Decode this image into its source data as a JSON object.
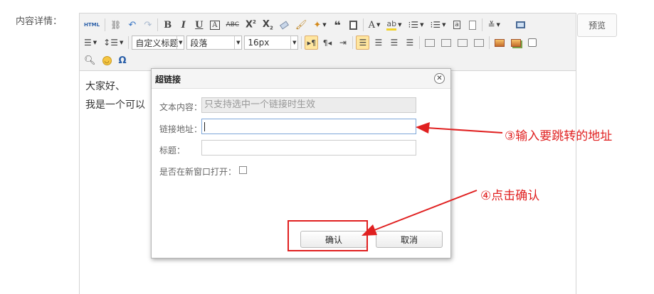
{
  "form": {
    "field_label": "内容详情："
  },
  "editor": {
    "style_select": "自定义标题",
    "paragraph_select": "段落",
    "fontsize_select": "16px",
    "content_lines": [
      "大家好、",
      "我是一个可以"
    ]
  },
  "preview_label": "预览",
  "dialog": {
    "title": "超链接",
    "close_glyph": "✕",
    "text_label": "文本内容：",
    "text_placeholder": "只支持选中一个链接时生效",
    "url_label": "链接地址：",
    "url_value": "",
    "title_label": "标题：",
    "title_value": "",
    "newwin_label": "是否在新窗口打开：",
    "newwin_checked": false,
    "ok_label": "确认",
    "cancel_label": "取消"
  },
  "annotations": {
    "step3": "③输入要跳转的地址",
    "step4": "④点击确认",
    "color": "#e02020"
  },
  "toolbar": {
    "row1": [
      "html-source-icon",
      "link-icon",
      "undo-icon",
      "redo-icon",
      "bold-icon",
      "italic-icon",
      "underline-icon",
      "font-border-icon",
      "strikethrough-icon",
      "superscript-icon",
      "subscript-icon",
      "eraser-icon",
      "format-brush-icon",
      "magic-icon",
      "blockquote-icon",
      "paste-text-icon",
      "font-color-icon",
      "background-color-icon",
      "ordered-list-icon",
      "unordered-list-icon",
      "select-all-icon",
      "clear-doc-icon",
      "row-spacing-icon",
      "fullscreen-icon"
    ],
    "row2": [
      "paragraph-spacing-icon",
      "line-height-icon",
      "ltr-icon",
      "rtl-icon",
      "indent-icon",
      "align-left-icon",
      "align-center-icon",
      "align-right-icon",
      "align-justify-icon",
      "image-none-icon",
      "image-left-icon",
      "image-right-icon",
      "image-center-icon",
      "insert-image-icon",
      "insert-multi-image-icon",
      "video-icon"
    ],
    "row3": [
      "search-replace-icon",
      "emotion-icon",
      "special-char-icon"
    ]
  }
}
